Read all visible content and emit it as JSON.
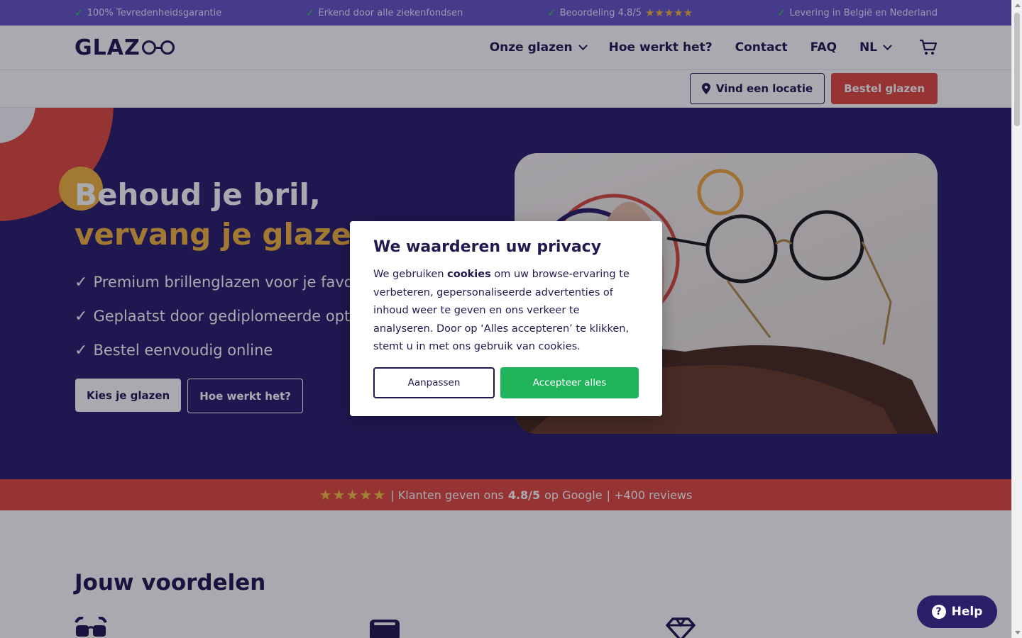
{
  "topbar": {
    "items": [
      {
        "label": "100% Tevredenheidsgarantie"
      },
      {
        "label": "Erkend door alle ziekenfondsen"
      },
      {
        "label": "Beoordeling 4.8/5",
        "stars": "★★★★★"
      },
      {
        "label": "Levering in België en Nederland"
      }
    ]
  },
  "header": {
    "logo_text": "GLAZ",
    "nav": {
      "glazen": "Onze glazen",
      "hoe": "Hoe werkt het?",
      "contact": "Contact",
      "faq": "FAQ",
      "lang": "NL"
    },
    "cart_icon": "cart-icon"
  },
  "subheader": {
    "location_button": "Vind een locatie",
    "order_button": "Bestel glazen"
  },
  "hero": {
    "title_line1": "Behoud je bril,",
    "title_line2": "vervang je glazen.",
    "features": [
      "Premium brillenglazen voor je favoriete",
      "Geplaatst door gediplomeerde opticiens",
      "Bestel eenvoudig online"
    ],
    "primary_button": "Kies je glazen",
    "secondary_button": "Hoe werkt het?"
  },
  "review_strip": {
    "stars": "★★★★★",
    "prefix": "| Klanten geven ons",
    "rating": "4.8/5",
    "middle": "op Google",
    "suffix": "| +400 reviews"
  },
  "benefits": {
    "title": "Jouw voordelen",
    "icons": [
      "glasses-icon",
      "wallet-icon",
      "diamond-icon"
    ]
  },
  "cookie_modal": {
    "title": "We waarderen uw privacy",
    "text_before": "We gebruiken",
    "text_bold": "cookies",
    "text_after": "om uw browse-ervaring te verbeteren,  gepersonaliseerde advertenties of inhoud weer te geven en ons verkeer te analyseren. Door op ‘Alles accepteren’ te klikken, stemt u in met ons gebruik van cookies.",
    "customize_button": "Aanpassen",
    "accept_button": "Accepteer alles"
  },
  "help_button": {
    "label": "Help",
    "icon_glyph": "?"
  },
  "colors": {
    "brand_navy": "#2b1f6a",
    "topbar_purple": "#6756c7",
    "accent_red": "#e04c3f",
    "accent_yellow": "#f5b640",
    "accept_green": "#1fb35a"
  }
}
